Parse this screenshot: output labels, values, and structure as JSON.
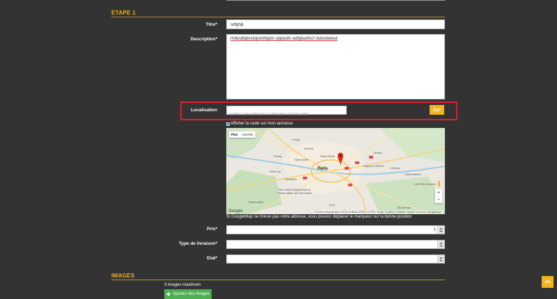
{
  "step1": {
    "title": "ETAPE 1"
  },
  "form": {
    "titre_label": "Titre*",
    "titre_value": "sdfghjk",
    "description_label": "Description*",
    "description_value": "rfvlbndfgbnnfgndnfdgdn xlgbedfx wdfgbedfxcf dwbxdwbxd",
    "localisation_label": "Localisation",
    "localisation_placeholder": "Entrer une adresse à chercher sur la carte",
    "go_label": "Go!",
    "show_map_label": "Afficher la carte sur mon annonce",
    "map": {
      "tab_plan": "Plan",
      "tab_satellite": "Satellite",
      "city_paris": "Paris",
      "places": [
        "Cergy",
        "Saint-Denis",
        "Meaux",
        "Versailles",
        "Evry",
        "Rambouillet",
        "Poissy",
        "Chessy",
        "Lagny-sur-Marne",
        "Sartrouville",
        "Montereau",
        "La Ferté-Gaucher",
        "Parc naturel régional de la Haute Vallée de Chevreuse",
        "Ermont",
        "Coulommiers",
        "Saint-Cyr"
      ],
      "google": "Google",
      "footer": "Données cartographiques ©2018 GeoBasis-DE/BKG (©2009), Google   Conditions d'utilisation   Signaler une erreur cartographique",
      "zoom_in": "+",
      "zoom_out": "−"
    },
    "map_hint": "Si GoogleMap ne trouve pas votre adresse, vous pouvez déplacer le marqueur sur la bonne position",
    "prix_label": "Prix*",
    "prix_currency": "$",
    "livraison_label": "Type de livraison*",
    "etat_label": "Etat*"
  },
  "images": {
    "title": "IMAGES",
    "max_note": "3 images maximum",
    "add_label": "Ajoutez des images"
  },
  "colors": {
    "accent": "#f3b51d",
    "background": "#333333",
    "highlight": "#e31c25",
    "add_button": "#4caf50"
  }
}
